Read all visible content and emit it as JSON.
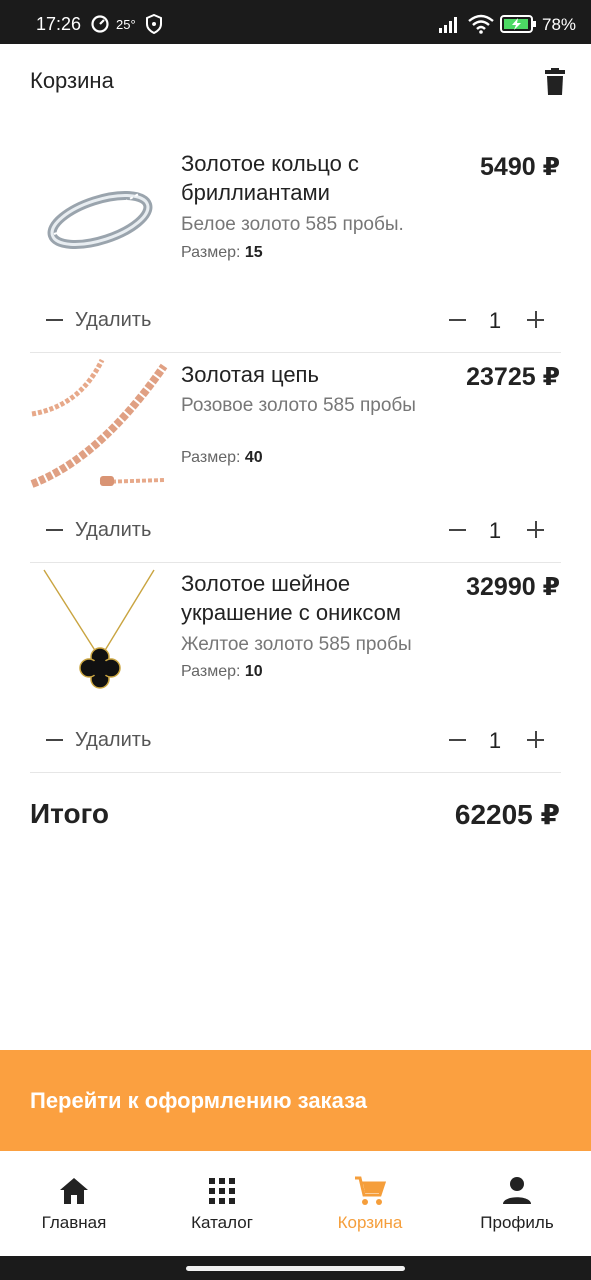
{
  "status_bar": {
    "time": "17:26",
    "temperature": "25°",
    "battery": "78%"
  },
  "header": {
    "title": "Корзина",
    "icon": "trash-icon"
  },
  "items": [
    {
      "name": "Золотое кольцо с бриллиантами",
      "description": "Белое золото 585 пробы.",
      "size_label": "Размер:",
      "size": "15",
      "price": "5490 ₽",
      "remove_label": "Удалить",
      "quantity": "1"
    },
    {
      "name": "Золотая цепь",
      "description": "Розовое золото 585 пробы",
      "size_label": "Размер:",
      "size": "40",
      "price": "23725 ₽",
      "remove_label": "Удалить",
      "quantity": "1"
    },
    {
      "name": "Золотое шейное украшение с ониксом",
      "description": "Желтое золото 585 пробы",
      "size_label": "Размер:",
      "size": "10",
      "price": "32990 ₽",
      "remove_label": "Удалить",
      "quantity": "1"
    }
  ],
  "total": {
    "label": "Итого",
    "value": "62205 ₽"
  },
  "checkout": {
    "label": "Перейти к оформлению заказа",
    "color": "#fba040"
  },
  "nav": [
    {
      "label": "Главная",
      "icon": "home-icon",
      "active": false
    },
    {
      "label": "Каталог",
      "icon": "grid-icon",
      "active": false
    },
    {
      "label": "Корзина",
      "icon": "cart-icon",
      "active": true
    },
    {
      "label": "Профиль",
      "icon": "person-icon",
      "active": false
    }
  ],
  "colors": {
    "accent": "#f59e3b",
    "checkout_bg": "#fba040"
  }
}
